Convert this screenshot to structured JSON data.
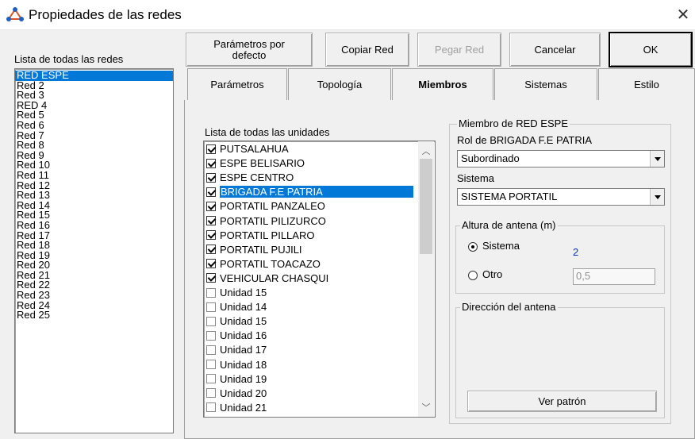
{
  "window": {
    "title": "Propiedades de las redes",
    "close": "✕"
  },
  "toolbar": {
    "defaults_label": "Parámetros por defecto",
    "copy_label": "Copiar Red",
    "paste_label": "Pegar Red",
    "cancel_label": "Cancelar",
    "ok_label": "OK"
  },
  "networks": {
    "header": "Lista de todas las redes",
    "selected_index": 0,
    "items": [
      "RED ESPE",
      "Red  2",
      "Red  3",
      "RED 4",
      "Red  5",
      "Red  6",
      "Red  7",
      "Red  8",
      "Red  9",
      "Red 10",
      "Red 11",
      "Red 12",
      "Red 13",
      "Red 14",
      "Red 15",
      "Red 16",
      "Red 17",
      "Red 18",
      "Red 19",
      "Red 20",
      "Red 21",
      "Red 22",
      "Red 23",
      "Red 24",
      "Red 25"
    ]
  },
  "tabs": [
    {
      "label": "Parámetros",
      "active": false
    },
    {
      "label": "Topología",
      "active": false
    },
    {
      "label": "Miembros",
      "active": true
    },
    {
      "label": "Sistemas",
      "active": false
    },
    {
      "label": "Estilo",
      "active": false
    }
  ],
  "units": {
    "header": "Lista de todas las unidades",
    "items": [
      {
        "label": "PUTSALAHUA",
        "checked": true,
        "selected": false
      },
      {
        "label": "ESPE BELISARIO",
        "checked": true,
        "selected": false
      },
      {
        "label": "ESPE CENTRO",
        "checked": true,
        "selected": false
      },
      {
        "label": "BRIGADA F.E PATRIA",
        "checked": true,
        "selected": true
      },
      {
        "label": "PORTATIL PANZALEO",
        "checked": true,
        "selected": false
      },
      {
        "label": "PORTATIL PILIZURCO",
        "checked": true,
        "selected": false
      },
      {
        "label": "PORTATIL PILLARO",
        "checked": true,
        "selected": false
      },
      {
        "label": "PORTATIL PUJILI",
        "checked": true,
        "selected": false
      },
      {
        "label": "PORTATIL  TOACAZO",
        "checked": true,
        "selected": false
      },
      {
        "label": "VEHICULAR CHASQUI",
        "checked": true,
        "selected": false
      },
      {
        "label": "Unidad  15",
        "checked": false,
        "selected": false
      },
      {
        "label": "Unidad  14",
        "checked": false,
        "selected": false
      },
      {
        "label": "Unidad   15",
        "checked": false,
        "selected": false
      },
      {
        "label": "Unidad   16",
        "checked": false,
        "selected": false
      },
      {
        "label": "Unidad   17",
        "checked": false,
        "selected": false
      },
      {
        "label": "Unidad   18",
        "checked": false,
        "selected": false
      },
      {
        "label": "Unidad   19",
        "checked": false,
        "selected": false
      },
      {
        "label": "Unidad   20",
        "checked": false,
        "selected": false
      },
      {
        "label": "Unidad   21",
        "checked": false,
        "selected": false
      }
    ]
  },
  "member": {
    "group_title": "Miembro de RED ESPE",
    "role_label": "Rol de BRIGADA F.E PATRIA",
    "role_value": "Subordinado",
    "system_label": "Sistema",
    "system_value": "SISTEMA PORTATIL",
    "antenna_height": {
      "title": "Altura de antena (m)",
      "system_option": "Sistema",
      "system_value": "2",
      "other_option": "Otro",
      "other_value": "0,5",
      "selected": "Sistema"
    },
    "antenna_direction": {
      "title": "Dirección del antena",
      "pattern_button": "Ver patrón"
    }
  },
  "colors": {
    "selection": "#0078d7",
    "value_blue": "#0033cc"
  }
}
